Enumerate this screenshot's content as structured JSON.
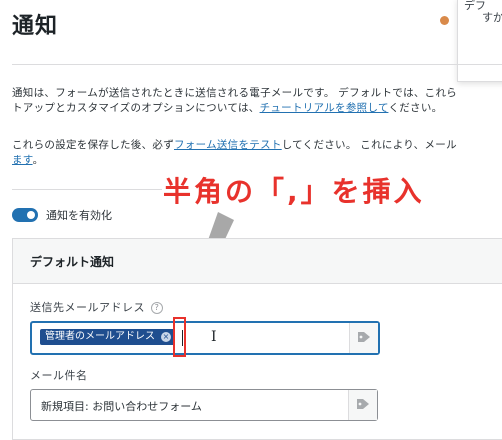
{
  "page": {
    "title": "通知"
  },
  "popup": {
    "line1": "デフ",
    "line2": "すか"
  },
  "intro": {
    "line1": "通知は、フォームが送信されたときに送信される電子メールです。 デフォルトでは、これら",
    "line2_before": "トアップとカスタマイズのオプションについては、",
    "line2_link": "チュートリアルを参照して",
    "line2_after": "ください。",
    "line3_before": "これらの設定を保存した後、必ず",
    "line3_link": "フォーム送信をテスト",
    "line3_after": "してください。 これにより、メール",
    "line4_link": "ます",
    "line4_after": "。"
  },
  "annotation": {
    "text": "半角の「,」を挿入"
  },
  "toggle": {
    "label": "通知を有効化",
    "enabled": true
  },
  "card": {
    "title": "デフォルト通知",
    "recipient": {
      "label": "送信先メールアドレス",
      "help_icon": "?",
      "tag": "管理者のメールアドレス",
      "tag_remove": "×"
    },
    "subject": {
      "label": "メール件名",
      "value": "新規項目: お問い合わせフォーム"
    }
  },
  "colors": {
    "accent": "#2271b1",
    "annotation_red": "#e8322c",
    "chip_bg": "#1f4e8f",
    "status_dot": "#d98a4a"
  },
  "icons": [
    "help-icon",
    "tag-icon",
    "close-icon",
    "text-cursor-icon",
    "arrow-icon"
  ]
}
